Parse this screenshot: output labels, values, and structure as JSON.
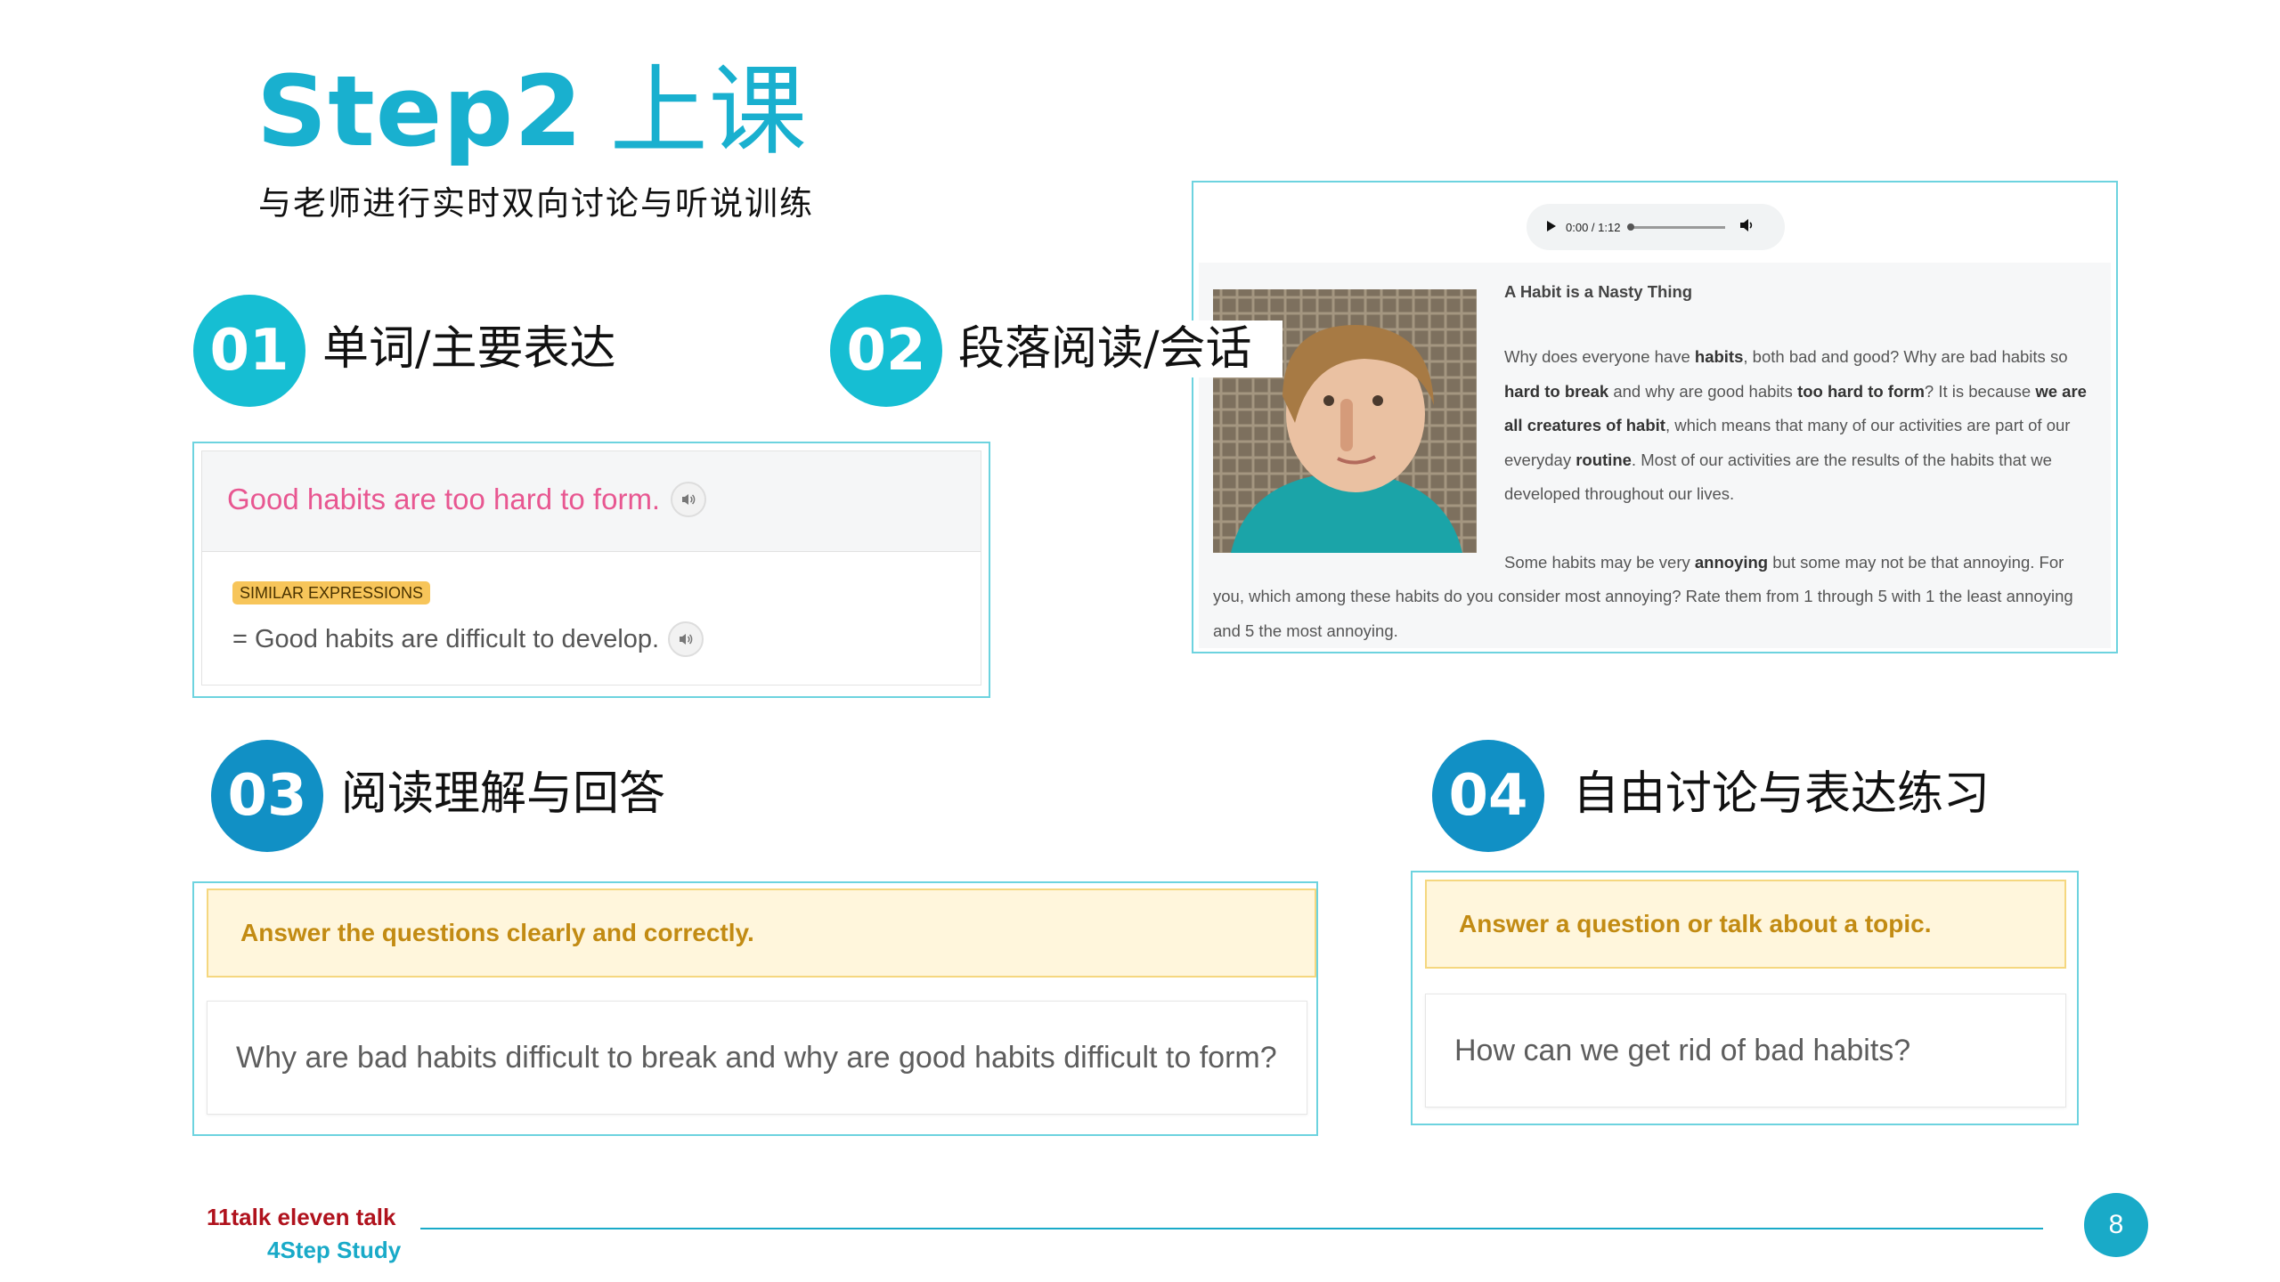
{
  "title": {
    "step": "Step2",
    "cn": "上课"
  },
  "subtitle": "与老师进行实时双向讨论与听说训练",
  "sections": [
    {
      "num": "01",
      "label": "单词/主要表达"
    },
    {
      "num": "02",
      "label": "段落阅读/会话"
    },
    {
      "num": "03",
      "label": "阅读理解与回答"
    },
    {
      "num": "04",
      "label": "自由讨论与表达练习"
    }
  ],
  "vocab": {
    "expression": "Good habits are too hard to form.",
    "badge": "SIMILAR EXPRESSIONS",
    "similar": "= Good habits are difficult to develop."
  },
  "reading": {
    "audio_time": "0:00 / 1:12",
    "title": "A Habit is a Nasty Thing"
  },
  "comprehension": {
    "instruction": "Answer the questions clearly and correctly.",
    "question": "Why are bad habits difficult to break and why are good habits difficult to form?"
  },
  "discussion": {
    "instruction": "Answer a question or talk about a topic.",
    "question": "How can we get rid of bad habits?"
  },
  "footer": {
    "brand_line1": "11talk eleven talk",
    "brand_line2": "4Step Study",
    "page_number": "8"
  },
  "icons": [
    "speaker-icon",
    "play-icon",
    "volume-icon"
  ],
  "colors": {
    "accent": "#19b0cf",
    "circle_cyan": "#16bed3",
    "circle_blue": "#1190c5",
    "pink": "#e85791",
    "instruction": "#c28b13",
    "brand_red": "#b0121d"
  }
}
